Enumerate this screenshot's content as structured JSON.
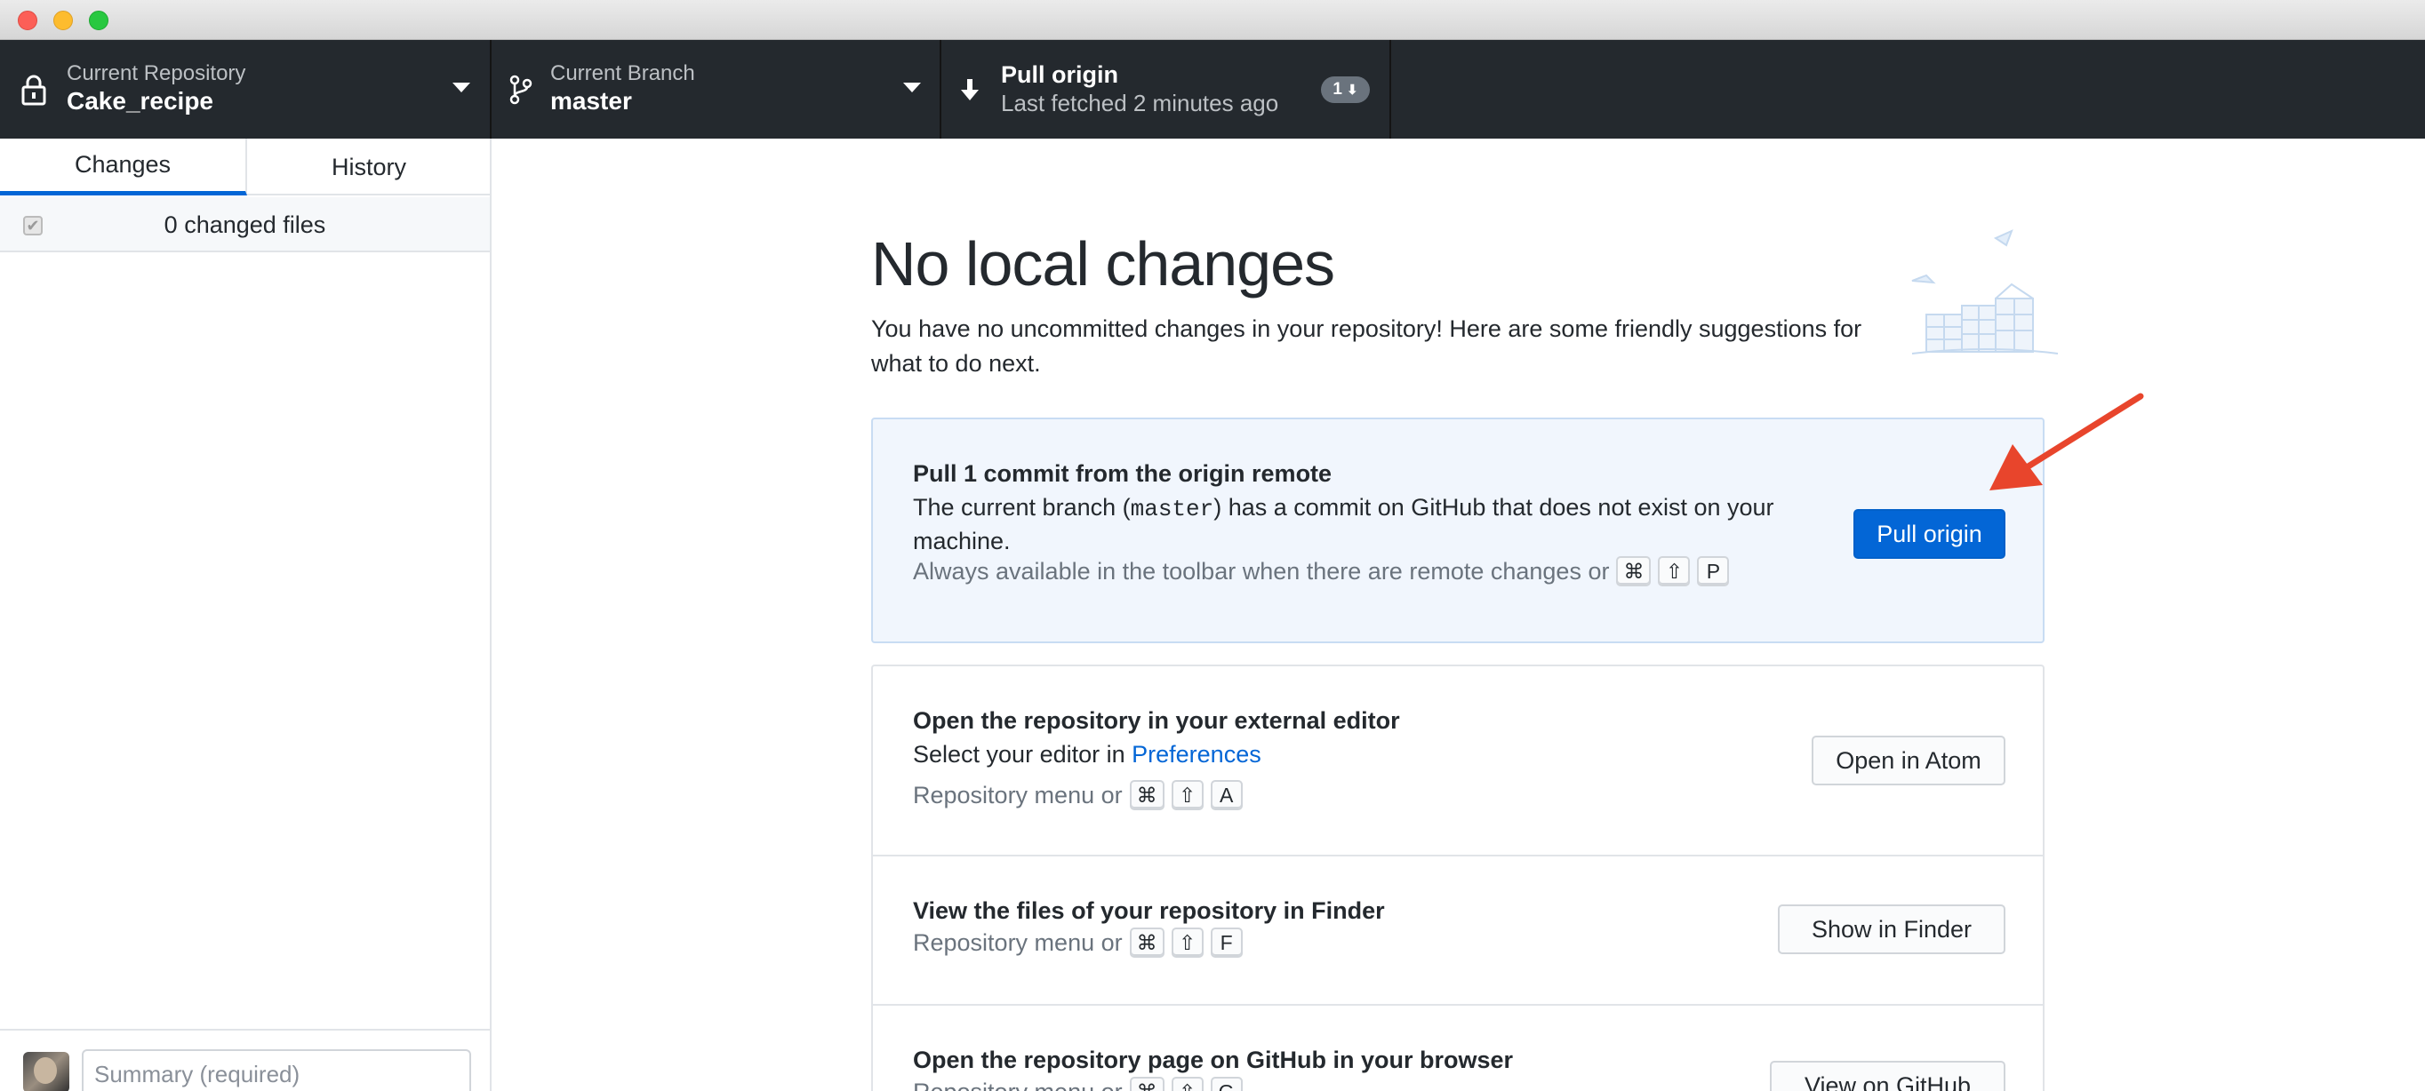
{
  "toolbar": {
    "repository": {
      "description": "Current Repository",
      "title": "Cake_recipe"
    },
    "branch": {
      "description": "Current Branch",
      "title": "master"
    },
    "pull": {
      "title": "Pull origin",
      "description": "Last fetched 2 minutes ago",
      "badge_count": "1"
    }
  },
  "sidebar": {
    "tabs": [
      {
        "label": "Changes",
        "selected": true
      },
      {
        "label": "History",
        "selected": false
      }
    ],
    "changed_files_label": "0 changed files",
    "summary_placeholder": "Summary (required)"
  },
  "main": {
    "heading": "No local changes",
    "subtext": "You have no uncommitted changes in your repository! Here are some friendly suggestions for what to do next.",
    "pull_callout": {
      "title": "Pull 1 commit from the origin remote",
      "text_before": "The current branch (",
      "branch": "master",
      "text_after": ") has a commit on GitHub that does not exist on your",
      "text_line2": "machine.",
      "hint": "Always available in the toolbar when there are remote changes or",
      "keys": [
        "⌘",
        "⇧",
        "P"
      ],
      "button": "Pull origin"
    },
    "suggestions": [
      {
        "title": "Open the repository in your external editor",
        "text": "Select your editor in",
        "link": "Preferences",
        "hint": "Repository menu or",
        "keys": [
          "⌘",
          "⇧",
          "A"
        ],
        "button": "Open in Atom"
      },
      {
        "title": "View the files of your repository in Finder",
        "hint": "Repository menu or",
        "keys": [
          "⌘",
          "⇧",
          "F"
        ],
        "button": "Show in Finder"
      },
      {
        "title": "Open the repository page on GitHub in your browser",
        "hint": "Repository menu or",
        "keys": [
          "⌘",
          "⇧",
          "G"
        ],
        "button": "View on GitHub"
      }
    ]
  },
  "colors": {
    "accent": "#0366d6",
    "toolbar_bg": "#24292e",
    "annotation_arrow": "#e8452c"
  }
}
